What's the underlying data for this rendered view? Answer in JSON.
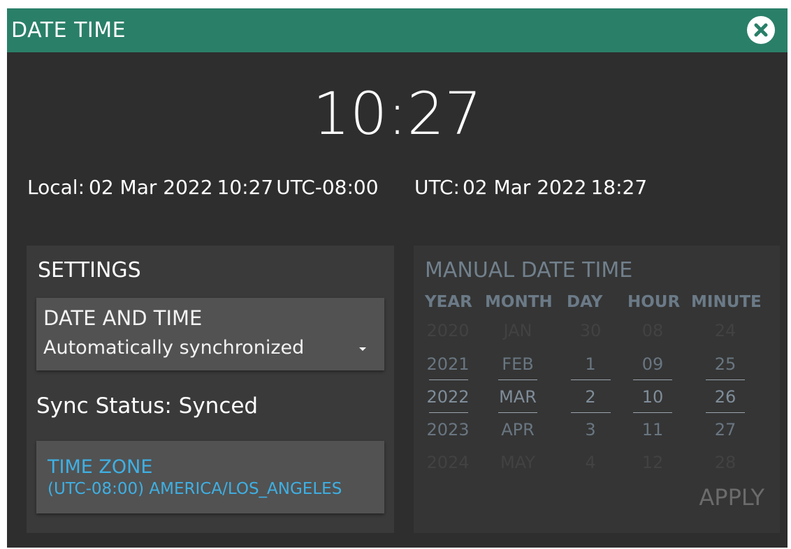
{
  "window": {
    "title": "DATE TIME"
  },
  "clock": {
    "time": "10:27"
  },
  "local": {
    "label": "Local:",
    "date": "02 Mar 2022",
    "time": "10:27",
    "offset": "UTC-08:00"
  },
  "utc": {
    "label": "UTC:",
    "date": "02 Mar 2022",
    "time": "18:27"
  },
  "settings": {
    "title": "SETTINGS",
    "date_time_label": "DATE AND TIME",
    "date_time_value": "Automatically synchronized",
    "sync_status": "Sync Status: Synced",
    "time_zone_label": "TIME ZONE",
    "time_zone_value": "(UTC-08:00) AMERICA/LOS_ANGELES"
  },
  "manual": {
    "title": "MANUAL DATE TIME",
    "headers": {
      "year": "YEAR",
      "month": "MONTH",
      "day": "DAY",
      "hour": "HOUR",
      "minute": "MINUTE"
    },
    "year": [
      "2020",
      "2021",
      "2022",
      "2023",
      "2024"
    ],
    "month": [
      "JAN",
      "FEB",
      "MAR",
      "APR",
      "MAY"
    ],
    "day": [
      "30",
      "1",
      "2",
      "3",
      "4"
    ],
    "hour": [
      "08",
      "09",
      "10",
      "11",
      "12"
    ],
    "minute": [
      "24",
      "25",
      "26",
      "27",
      "28"
    ],
    "apply_label": "APPLY"
  },
  "colors": {
    "title_bar": "#2a7f68",
    "background": "#2e2e2e",
    "panel": "#3a3a3a",
    "accent_link": "#3eb0e4"
  },
  "icons": {
    "close": "close-circle-icon",
    "dropdown": "caret-down-icon"
  }
}
